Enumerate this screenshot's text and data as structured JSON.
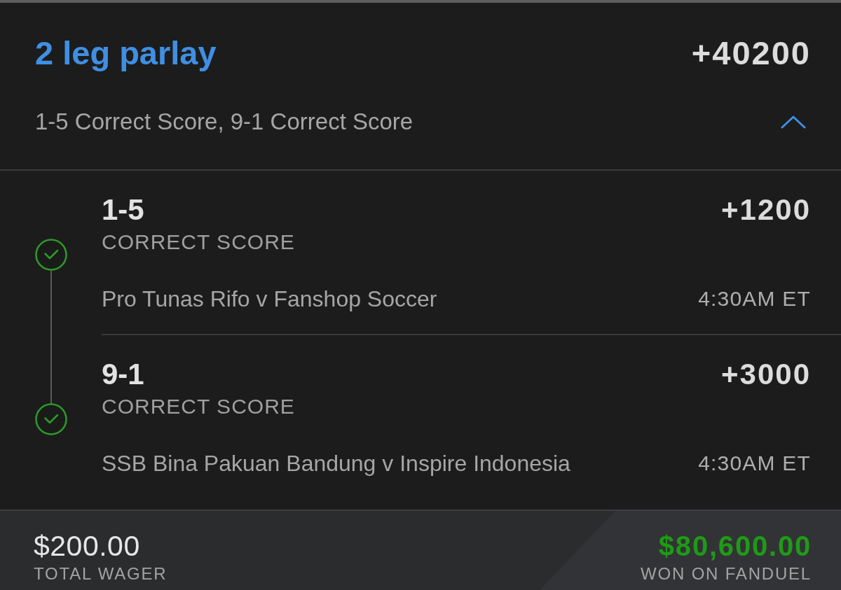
{
  "bet": {
    "title": "2 leg parlay",
    "odds": "+40200",
    "summary": "1-5 Correct Score, 9-1 Correct Score",
    "expanded": true
  },
  "legs": [
    {
      "selection": "1-5",
      "odds": "+1200",
      "market": "CORRECT SCORE",
      "event": "Pro Tunas Rifo v Fanshop Soccer",
      "time": "4:30AM ET",
      "won": true
    },
    {
      "selection": "9-1",
      "odds": "+3000",
      "market": "CORRECT SCORE",
      "event": "SSB Bina Pakuan Bandung v Inspire Indonesia",
      "time": "4:30AM ET",
      "won": true
    }
  ],
  "totals": {
    "wager": "$200.00",
    "wager_label": "TOTAL WAGER",
    "payout": "$80,600.00",
    "payout_label": "WON ON FANDUEL",
    "won": true
  }
}
